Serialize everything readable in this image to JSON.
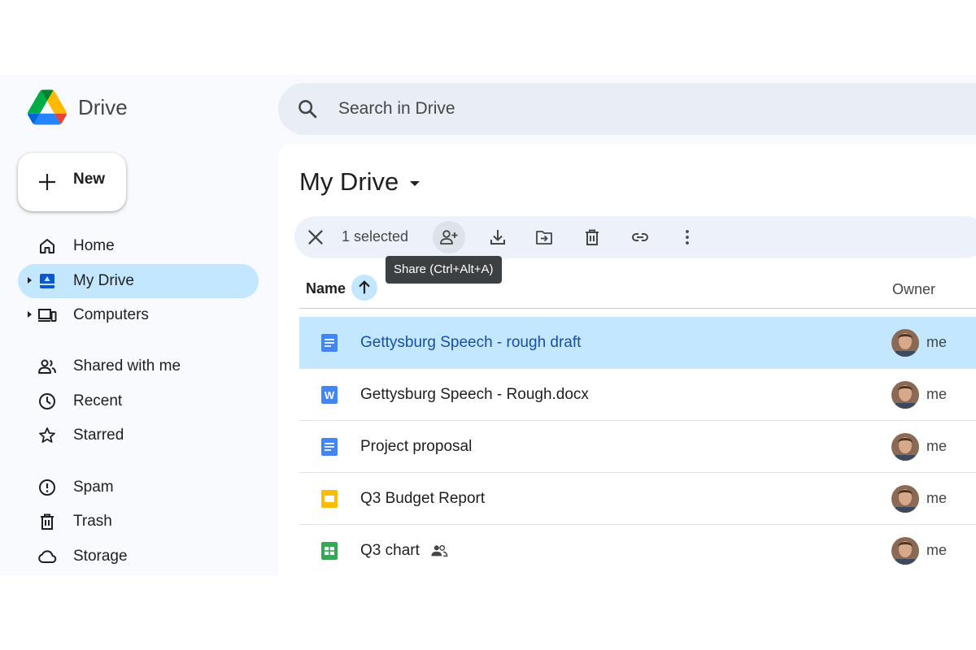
{
  "app": {
    "name": "Drive"
  },
  "search": {
    "placeholder": "Search in Drive"
  },
  "new_button": {
    "label": "New"
  },
  "sidebar": {
    "items": [
      {
        "label": "Home",
        "icon": "home-icon",
        "active": false
      },
      {
        "label": "My Drive",
        "icon": "my-drive-icon",
        "active": true
      },
      {
        "label": "Computers",
        "icon": "computers-icon",
        "active": false
      },
      {
        "label": "Shared with me",
        "icon": "shared-with-me-icon",
        "active": false
      },
      {
        "label": "Recent",
        "icon": "clock-icon",
        "active": false
      },
      {
        "label": "Starred",
        "icon": "star-icon",
        "active": false
      },
      {
        "label": "Spam",
        "icon": "spam-icon",
        "active": false
      },
      {
        "label": "Trash",
        "icon": "trash-icon",
        "active": false
      },
      {
        "label": "Storage",
        "icon": "cloud-icon",
        "active": false
      }
    ]
  },
  "main": {
    "title": "My Drive",
    "action_bar": {
      "selected_text": "1 selected",
      "tooltip": "Share (Ctrl+Alt+A)"
    },
    "columns": {
      "name": "Name",
      "owner": "Owner"
    },
    "files": [
      {
        "name": "Gettysburg Speech - rough draft",
        "type": "google-doc",
        "owner": "me",
        "selected": true,
        "shared": false
      },
      {
        "name": "Gettysburg Speech - Rough.docx",
        "type": "word-doc",
        "owner": "me",
        "selected": false,
        "shared": false
      },
      {
        "name": "Project proposal",
        "type": "google-doc",
        "owner": "me",
        "selected": false,
        "shared": false
      },
      {
        "name": "Q3 Budget Report",
        "type": "google-slides",
        "owner": "me",
        "selected": false,
        "shared": false
      },
      {
        "name": "Q3 chart",
        "type": "google-sheets",
        "owner": "me",
        "selected": false,
        "shared": true
      }
    ]
  },
  "colors": {
    "accent": "#c2e7ff",
    "background": "#f8fafd",
    "search_bg": "#e9eef6",
    "doc_blue": "#4285f4",
    "slides_yellow": "#fbbc04",
    "sheets_green": "#34a853"
  }
}
